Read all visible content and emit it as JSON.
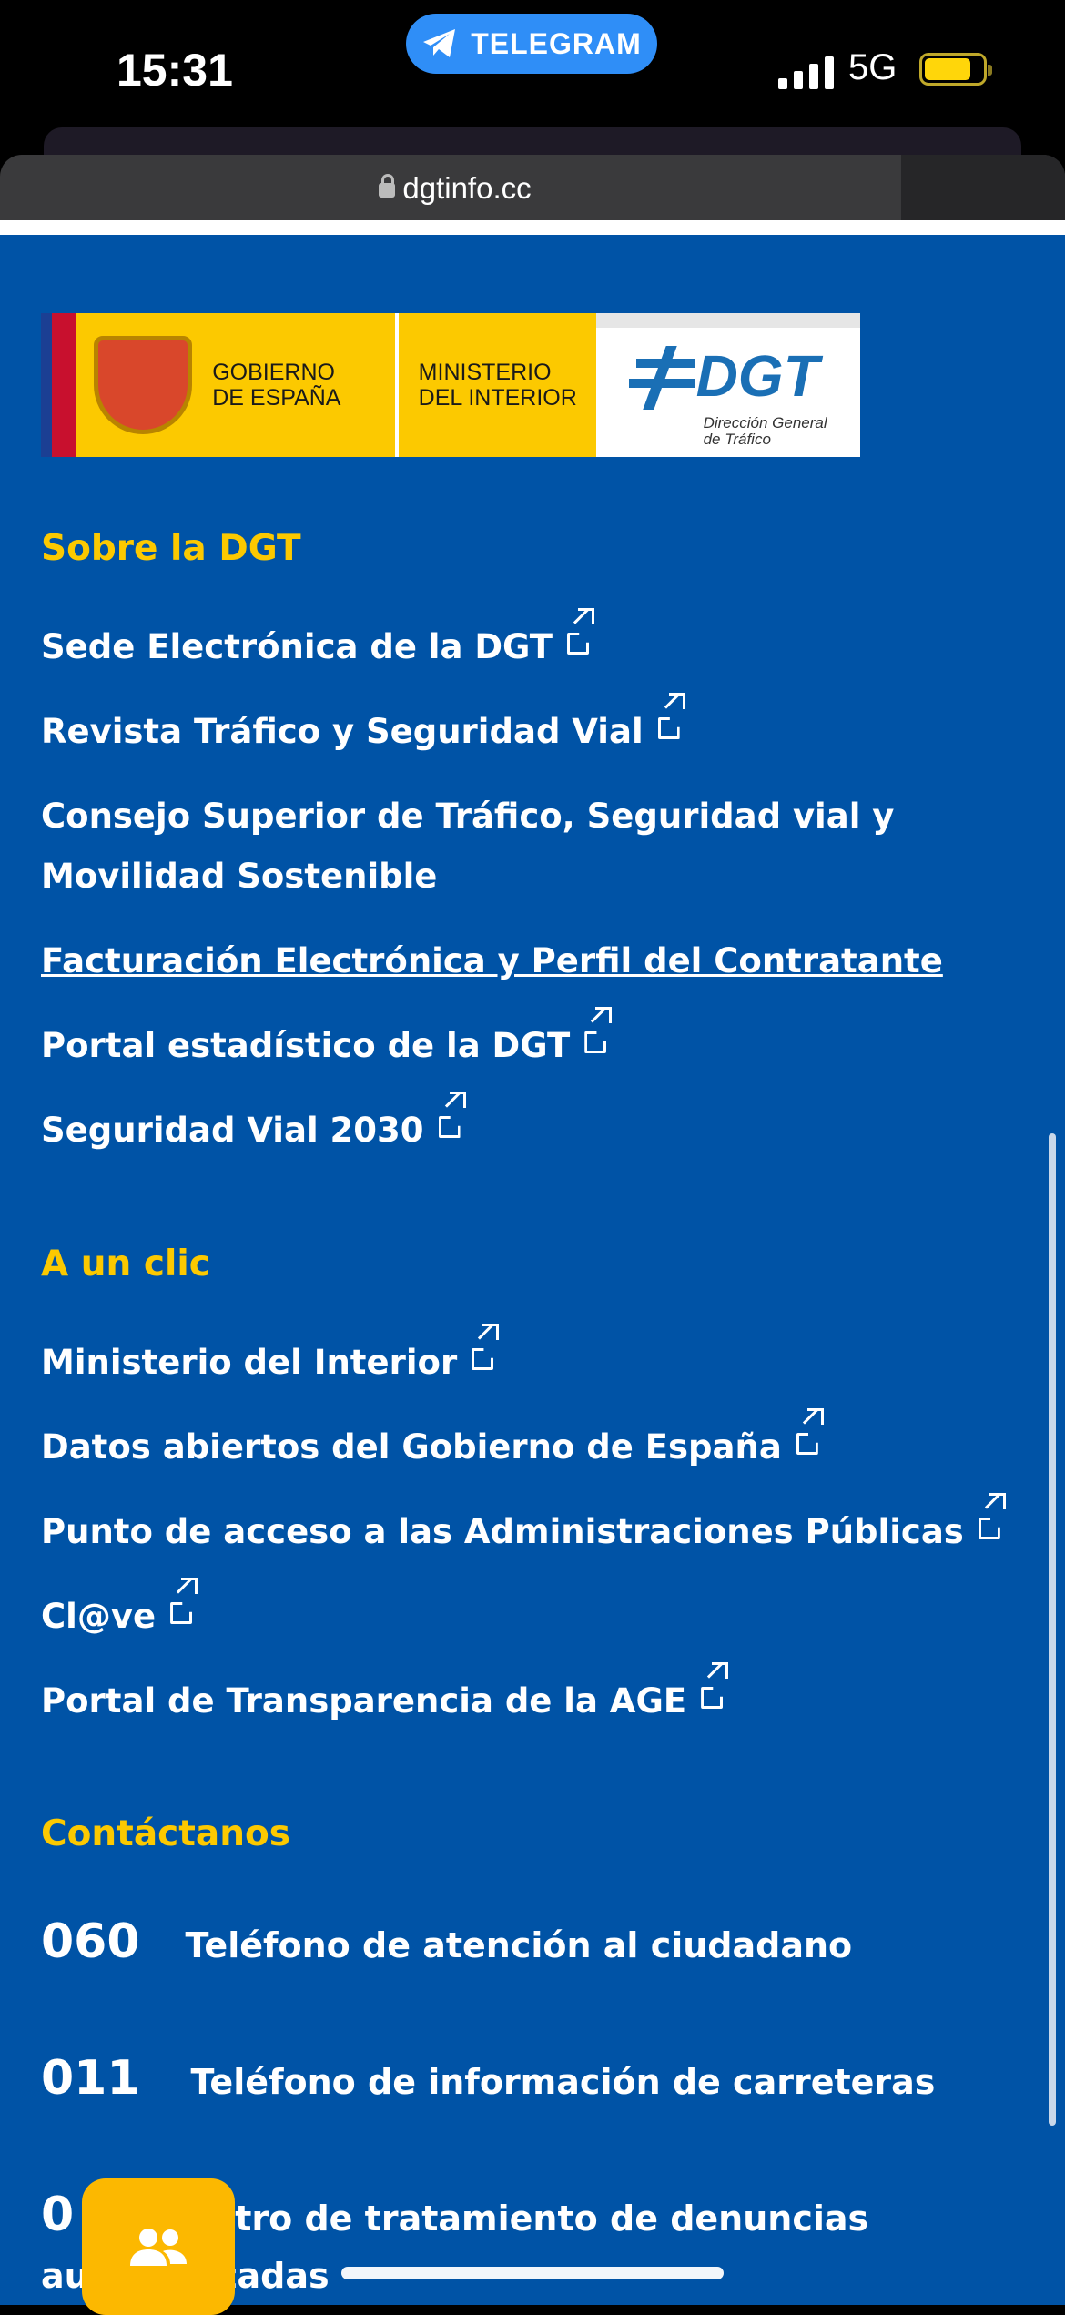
{
  "status": {
    "time": "15:31",
    "network": "5G",
    "pill_label": "TELEGRAM"
  },
  "browser": {
    "url": "dgtinfo.cc"
  },
  "logo": {
    "gobierno": "GOBIERNO DE ESPAÑA",
    "gobierno_l1": "GOBIERNO",
    "gobierno_l2": "DE ESPAÑA",
    "ministerio_l1": "MINISTERIO",
    "ministerio_l2": "DEL INTERIOR",
    "dgt": "DGT",
    "dgt_sub_l1": "Dirección General",
    "dgt_sub_l2": "de Tráfico"
  },
  "sobre": {
    "title": "Sobre la DGT",
    "links": [
      "Sede Electrónica de la DGT",
      "Revista Tráfico y Seguridad Vial",
      "Consejo Superior de Tráfico, Seguridad vial y",
      "Movilidad Sostenible",
      "Facturación Electrónica y Perfil del Contratante",
      "Portal estadístico de la DGT",
      "Seguridad Vial 2030"
    ]
  },
  "clic": {
    "title": "A un clic",
    "links": [
      "Ministerio del Interior",
      "Datos abiertos del Gobierno de España",
      "Punto de acceso a las Administraciones Públicas",
      "Cl@ve",
      "Portal de Transparencia de la AGE"
    ]
  },
  "contacto": {
    "title": "Contáctanos",
    "items": [
      {
        "num": "060",
        "label": "Teléfono de atención al ciudadano"
      },
      {
        "num": "011",
        "label": "Teléfono de información de carreteras"
      },
      {
        "num": "0",
        "label": "ntro de tratamiento de denuncias"
      },
      {
        "num": "",
        "label": "automatizadas"
      }
    ]
  },
  "colors": {
    "page_bg": "#0053a6",
    "accent": "#fcc900",
    "fab": "#fcb800"
  }
}
